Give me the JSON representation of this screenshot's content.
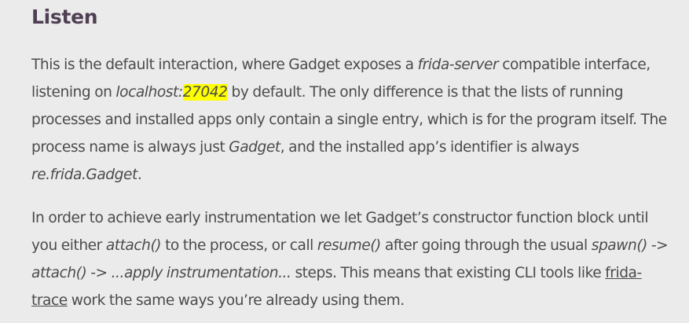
{
  "heading": "Listen",
  "p1": {
    "t1": "This is the default interaction, where Gadget exposes a ",
    "em_server": "frida-server",
    "t2": " compatible interface, listening on ",
    "em_host": "localhost:",
    "em_port": "27042",
    "t3": " by default. The only difference is that the lists of running processes and installed apps only contain a single entry, which is for the program itself. The process name is always just ",
    "em_gadget": "Gadget",
    "t4": ", and the installed app’s identifier is always ",
    "em_id": "re.frida.Gadget",
    "t5": "."
  },
  "p2": {
    "t1": "In order to achieve early instrumentation we let Gadget’s constructor function block until you either ",
    "em_attach": "attach()",
    "t2": " to the process, or call ",
    "em_resume": "resume()",
    "t3": " after going through the usual ",
    "em_flow": "spawn() -> attach() -> ...apply instrumentation...",
    "t4": " steps. This means that existing CLI tools like ",
    "link_trace": "frida-trace",
    "t5": " work the same ways you’re already using them."
  },
  "colors": {
    "background": "#ebebeb",
    "heading": "#4e3f53",
    "text": "#4b4b4b",
    "highlight": "#ffff00"
  }
}
